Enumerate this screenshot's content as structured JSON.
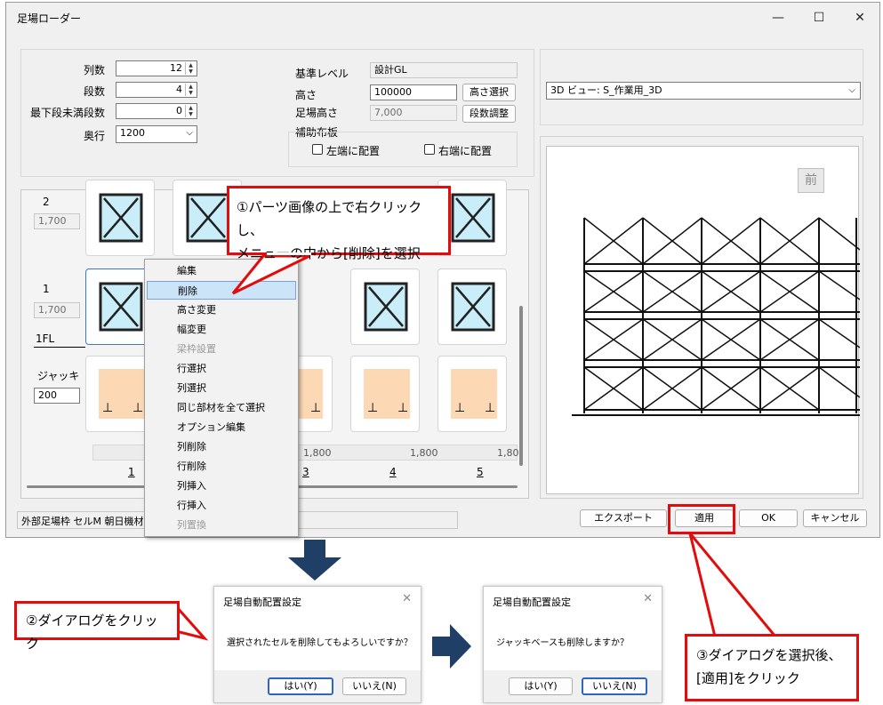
{
  "window": {
    "title": "足場ローダー",
    "minimize": "—",
    "maximize": "☐",
    "close": "✕"
  },
  "form": {
    "retsu_label": "列数",
    "retsu_value": "12",
    "dan_label": "段数",
    "dan_value": "4",
    "mini_label": "最下段未満段数",
    "mini_value": "0",
    "depth_label": "奥行",
    "depth_value": "1200",
    "base_label": "基準レベル",
    "base_value": "設計GL",
    "height_label": "高さ",
    "height_value": "100000",
    "height_btn": "高さ選択",
    "scaffold_h_label": "足場高さ",
    "scaffold_h_value": "7,000",
    "dan_btn": "段数調整",
    "plank_label": "補助布板",
    "left_chk": "左端に配置",
    "right_chk": "右端に配置"
  },
  "view": {
    "select": "3D ビュー: S_作業用_3D",
    "front_btn": "前"
  },
  "grid": {
    "row2_no": "2",
    "row2_h": "1,700",
    "row1_no": "1",
    "row1_h": "1,700",
    "floor": "1FL",
    "jack_label": "ジャッキ",
    "jack_value": "200",
    "widths": [
      "1,800",
      "1,800",
      "1,80"
    ],
    "cols": [
      "1",
      "3",
      "4",
      "5"
    ]
  },
  "status": {
    "text": "外部足場枠 セルM 朝日機材"
  },
  "buttons": {
    "export": "エクスポート",
    "apply": "適用",
    "ok": "OK",
    "cancel": "キャンセル"
  },
  "menu": {
    "items": [
      "編集",
      "削除",
      "高さ変更",
      "幅変更",
      "梁枠設置",
      "行選択",
      "列選択",
      "同じ部材を全て選択",
      "オプション編集",
      "列削除",
      "行削除",
      "列挿入",
      "行挿入",
      "列置換"
    ]
  },
  "callouts": {
    "c1_line1": "①パーツ画像の上で右クリックし、",
    "c1_line2": "メニューの中から[削除]を選択",
    "c2": "②ダイアログをクリック",
    "c3_line1": "③ダイアログを選択後、",
    "c3_line2": "[適用]をクリック"
  },
  "dialog1": {
    "title": "足場自動配置設定",
    "message": "選択されたセルを削除してもよろしいですか？",
    "yes": "はい(Y)",
    "no": "いいえ(N)"
  },
  "dialog2": {
    "title": "足場自動配置設定",
    "message": "ジャッキベースも削除しますか？",
    "yes": "はい(Y)",
    "no": "いいえ(N)"
  },
  "colors": {
    "accent_red": "#e30b0b",
    "arrow_blue": "#1f3f66",
    "menu_highlight": "#cce4f7",
    "jack_fill": "#fdd8b5",
    "frame_fill": "#c9eefa"
  }
}
